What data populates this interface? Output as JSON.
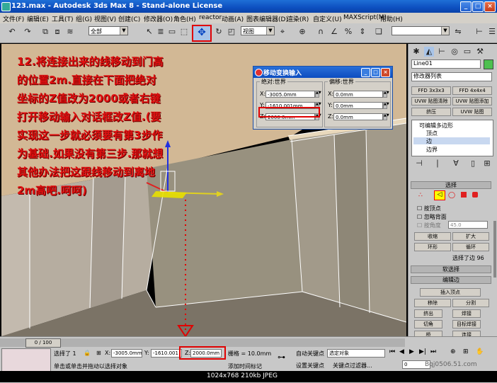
{
  "titlebar": {
    "title": "123.max - Autodesk 3ds Max 8 - Stand-alone License"
  },
  "menu": [
    "文件(F)",
    "编辑(E)",
    "工具(T)",
    "组(G)",
    "视图(V)",
    "创建(C)",
    "修改器(O)",
    "角色(H)",
    "reactor",
    "动画(A)",
    "图表编辑器(D)",
    "渲染(R)",
    "自定义(U)",
    "MAXScript(M)",
    "帮助(H)"
  ],
  "toolbar": {
    "selection_filter": "全部",
    "ref_coord": "视图"
  },
  "annotation": {
    "text": "12.将连接出来的线移动到门高的位置2m.直接在下面把绝对坐标的Z值改为2000或者右键打开移动输入对话框改Z值.(要实现这一步就必须要有第3步作为基础.如果没有第三步.那就想其他办法把这跟线移动到离地2m高吧.呵呵)"
  },
  "dialog": {
    "title": "移动变换输入",
    "absolute_label": "绝对:世界",
    "offset_label": "偏移:世界",
    "absolute": {
      "x": "-3005.0mm",
      "y": "-1610.001mm",
      "z": "2000.0mm"
    },
    "offset": {
      "x": "0.0mm",
      "y": "0.0mm",
      "z": "0.0mm"
    }
  },
  "panel": {
    "object_name": "Line01",
    "modifier_list": "修改器列表",
    "buttons": [
      "FFD 3x3x3",
      "FFD 4x4x4",
      "UVW 贴图清除",
      "UVW 贴图添加",
      "挤压",
      "UVW 贴图"
    ],
    "stack": [
      "可编辑多边形",
      "顶点",
      "边",
      "边界"
    ],
    "selection_rollout": "选择",
    "by_vertex": "按顶点",
    "ignore_backfacing": "忽略背面",
    "by_angle": "按角度",
    "angle_value": "45.0",
    "shrink": "收缩",
    "grow": "扩大",
    "ring": "环形",
    "loop": "循环",
    "selected_status": "选择了边 96",
    "soft_selection": "软选择",
    "edit_edges": "编辑边",
    "insert_vertex": "插入顶点",
    "remove": "移除",
    "split": "分割",
    "extrude": "挤出",
    "weld": "焊接",
    "chamfer": "切角",
    "target_weld": "目标焊接",
    "bridge": "桥",
    "connect": "连接"
  },
  "status": {
    "frame": "0 / 100",
    "selected": "选择了 1",
    "x": "-3005.0mm",
    "y": "-1610.001",
    "z": "2000.0mm",
    "grid": "栅格 = 10.0mm",
    "auto_key": "自动关键点",
    "selected_obj": "选定对象",
    "set_key": "设置关键点",
    "key_filters": "关键点过滤器...",
    "prompt": "单击或单击并拖动以选择对象",
    "add_time_tag": "添加时间标记",
    "frame_num": "0"
  },
  "caption": {
    "info": "1024x768  210kb  JPEG",
    "watermark": "Bqj0506.51.com"
  }
}
